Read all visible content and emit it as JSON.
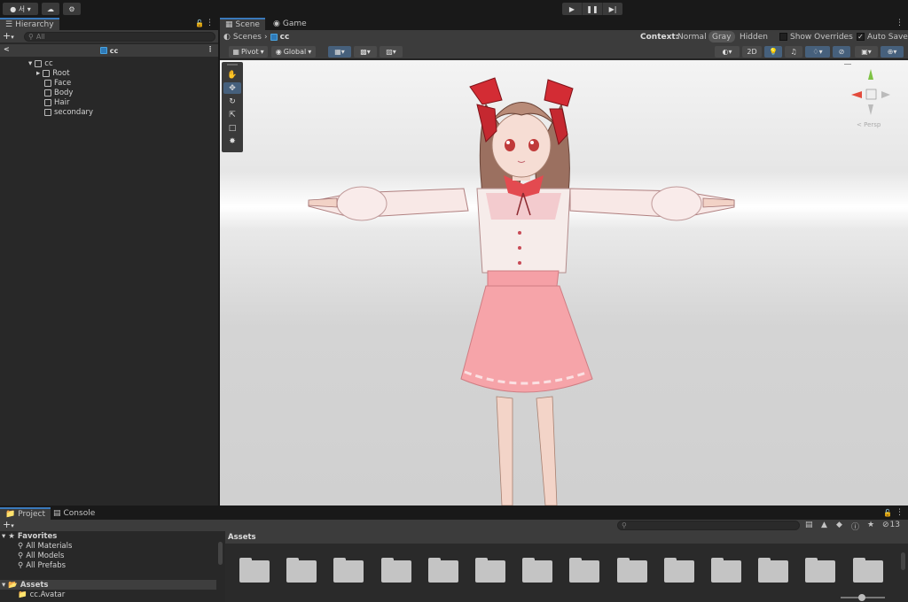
{
  "toolbar": {
    "account_label": "서",
    "cloud_icon": "cloud-icon",
    "services_icon": "gear-icon",
    "play_icon": "play-icon",
    "pause_icon": "pause-icon",
    "step_icon": "step-icon"
  },
  "hierarchy": {
    "tab_label": "Hierarchy",
    "search_placeholder": "All",
    "scene_name": "cc",
    "tree": [
      {
        "label": "cc",
        "level": 0,
        "expanded": true
      },
      {
        "label": "Root",
        "level": 1,
        "collapsed_arrow": true
      },
      {
        "label": "Face",
        "level": 1
      },
      {
        "label": "Body",
        "level": 1
      },
      {
        "label": "Hair",
        "level": 1
      },
      {
        "label": "secondary",
        "level": 1
      }
    ]
  },
  "scene": {
    "tabs": [
      {
        "label": "Scene",
        "active": true
      },
      {
        "label": "Game",
        "active": false
      }
    ],
    "breadcrumb_root": "Scenes",
    "breadcrumb_leaf": "cc",
    "context_label": "Context:",
    "context_options": [
      "Normal",
      "Gray",
      "Hidden"
    ],
    "context_selected": "Gray",
    "show_overrides_label": "Show Overrides",
    "show_overrides_checked": false,
    "auto_save_label": "Auto Save",
    "auto_save_checked": true,
    "pivot_label": "Pivot",
    "global_label": "Global",
    "mode_2d_label": "2D",
    "gizmo_label": "Persp",
    "accent_color": "#46607c"
  },
  "project": {
    "tabs": [
      {
        "label": "Project",
        "active": true
      },
      {
        "label": "Console",
        "active": false
      }
    ],
    "favorites_label": "Favorites",
    "favorites": [
      "All Materials",
      "All Models",
      "All Prefabs"
    ],
    "assets_label": "Assets",
    "assets_children": [
      "cc.Avatar"
    ],
    "assets_header": "Assets",
    "hidden_count": "13",
    "folder_count": 14
  }
}
